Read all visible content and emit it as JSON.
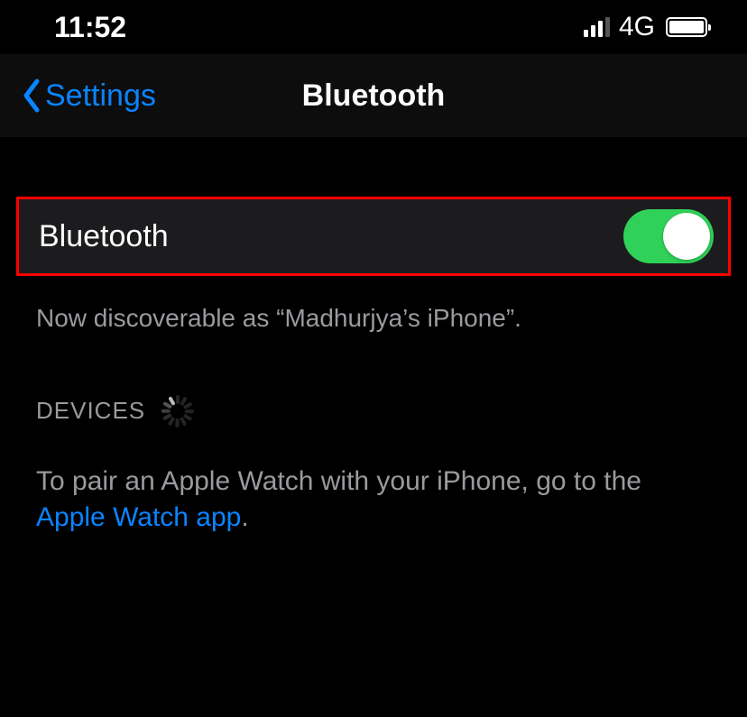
{
  "status_bar": {
    "time": "11:52",
    "network_type": "4G"
  },
  "nav": {
    "back_label": "Settings",
    "title": "Bluetooth"
  },
  "bluetooth_cell": {
    "label": "Bluetooth"
  },
  "discoverable_text": "Now discoverable as “Madhurjya’s iPhone”.",
  "devices_section_label": "DEVICES",
  "pair_text_prefix": "To pair an Apple Watch with your iPhone, go to the ",
  "pair_link_text": "Apple Watch app",
  "pair_text_suffix": "."
}
